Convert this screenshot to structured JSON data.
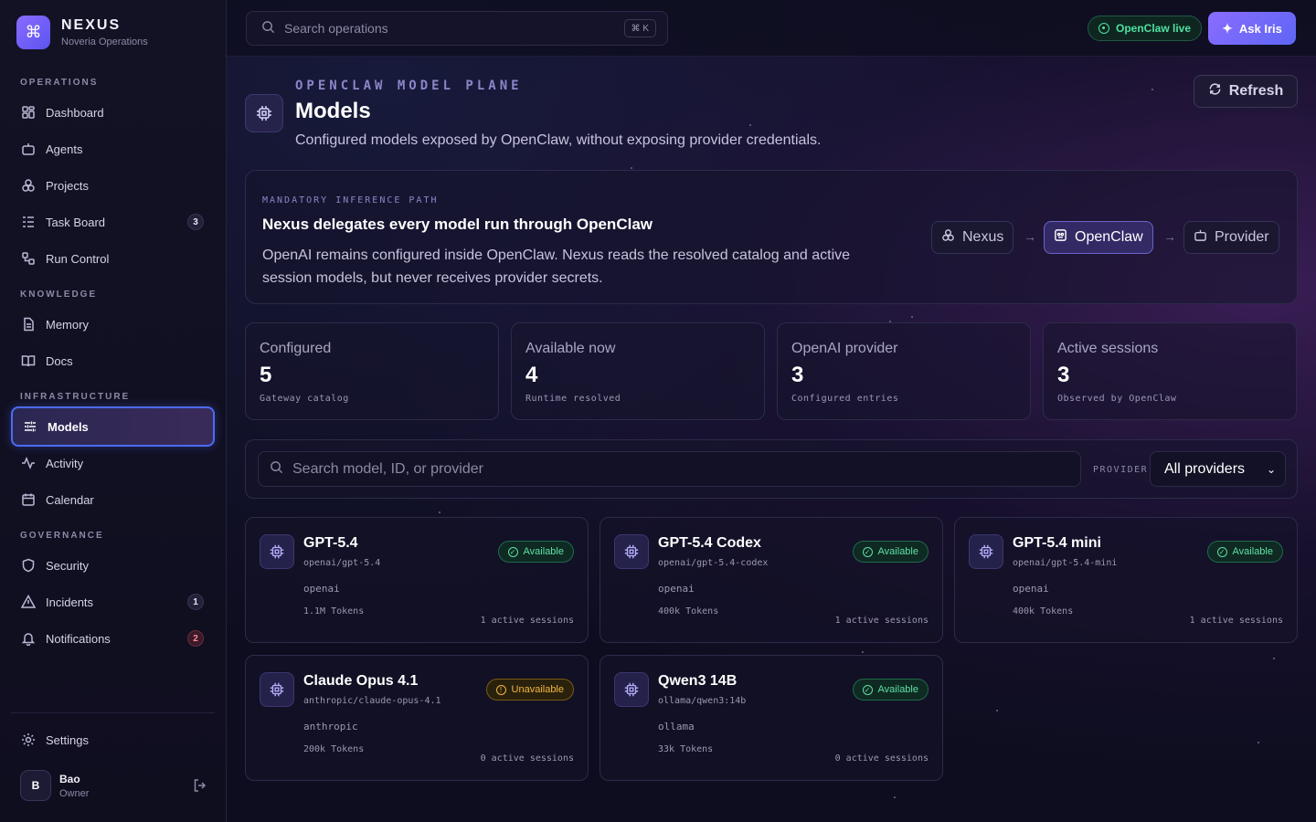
{
  "brand": {
    "name": "NEXUS",
    "subtitle": "Noveria Operations"
  },
  "sidebar": {
    "sections": {
      "operations": "OPERATIONS",
      "knowledge": "KNOWLEDGE",
      "infrastructure": "INFRASTRUCTURE",
      "governance": "GOVERNANCE"
    },
    "items": [
      {
        "label": "Dashboard",
        "icon": "grid-icon"
      },
      {
        "label": "Agents",
        "icon": "bot-icon"
      },
      {
        "label": "Projects",
        "icon": "projects-icon"
      },
      {
        "label": "Task Board",
        "icon": "list-icon",
        "badge": "3"
      },
      {
        "label": "Run Control",
        "icon": "workflow-icon"
      },
      {
        "label": "Memory",
        "icon": "file-icon"
      },
      {
        "label": "Docs",
        "icon": "book-icon"
      },
      {
        "label": "Models",
        "icon": "sliders-icon",
        "active": true
      },
      {
        "label": "Activity",
        "icon": "activity-icon"
      },
      {
        "label": "Calendar",
        "icon": "calendar-icon"
      },
      {
        "label": "Security",
        "icon": "shield-icon"
      },
      {
        "label": "Incidents",
        "icon": "alert-icon",
        "badge": "1"
      },
      {
        "label": "Notifications",
        "icon": "bell-icon",
        "badge": "2",
        "badge_color": "#ff8a9a"
      }
    ],
    "settings": "Settings",
    "user": {
      "initial": "B",
      "name": "Bao",
      "role": "Owner"
    }
  },
  "topbar": {
    "search_placeholder": "Search operations",
    "shortcut": "⌘ K",
    "live_label": "OpenClaw live",
    "ask_label": "Ask Iris"
  },
  "header": {
    "eyebrow": "OPENCLAW MODEL PLANE",
    "title": "Models",
    "subtitle": "Configured models exposed by OpenClaw, without exposing provider credentials.",
    "refresh": "Refresh"
  },
  "banner": {
    "eyebrow": "MANDATORY INFERENCE PATH",
    "title": "Nexus delegates every model run through OpenClaw",
    "text": "OpenAI remains configured inside OpenClaw. Nexus reads the resolved catalog and active session models, but never receives provider secrets.",
    "path": [
      "Nexus",
      "OpenClaw",
      "Provider"
    ]
  },
  "stats": [
    {
      "label": "Configured",
      "value": "5",
      "note": "Gateway catalog"
    },
    {
      "label": "Available now",
      "value": "4",
      "note": "Runtime resolved"
    },
    {
      "label": "OpenAI provider",
      "value": "3",
      "note": "Configured entries"
    },
    {
      "label": "Active sessions",
      "value": "3",
      "note": "Observed by OpenClaw"
    }
  ],
  "filter": {
    "placeholder": "Search model, ID, or provider",
    "provider_label": "PROVIDER",
    "provider_value": "All providers"
  },
  "models": [
    {
      "name": "GPT-5.4",
      "id": "openai/gpt-5.4",
      "provider": "openai",
      "tokens": "1.1M Tokens",
      "sessions": "1 active sessions",
      "status": "Available"
    },
    {
      "name": "GPT-5.4 Codex",
      "id": "openai/gpt-5.4-codex",
      "provider": "openai",
      "tokens": "400k Tokens",
      "sessions": "1 active sessions",
      "status": "Available"
    },
    {
      "name": "GPT-5.4 mini",
      "id": "openai/gpt-5.4-mini",
      "provider": "openai",
      "tokens": "400k Tokens",
      "sessions": "1 active sessions",
      "status": "Available"
    },
    {
      "name": "Claude Opus 4.1",
      "id": "anthropic/claude-opus-4.1",
      "provider": "anthropic",
      "tokens": "200k Tokens",
      "sessions": "0 active sessions",
      "status": "Unavailable"
    },
    {
      "name": "Qwen3 14B",
      "id": "ollama/qwen3:14b",
      "provider": "ollama",
      "tokens": "33k Tokens",
      "sessions": "0 active sessions",
      "status": "Available"
    }
  ],
  "colors": {
    "accent": "#7c6cff",
    "available": "#5ee0a6",
    "unavailable": "#f2b640",
    "active_border": "#4a6cf5"
  }
}
